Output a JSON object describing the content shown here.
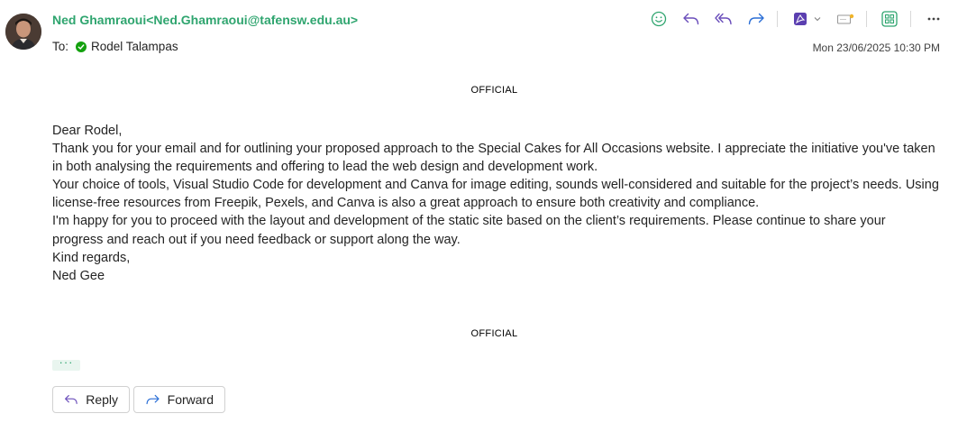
{
  "header": {
    "sender": "Ned Ghamraoui<Ned.Ghamraoui@tafensw.edu.au>",
    "to_label": "To:",
    "recipient": "Rodel Talampas",
    "date": "Mon 23/06/2025 10:30 PM"
  },
  "toolbar": {
    "icons": [
      "emoji-icon",
      "reply-icon",
      "reply-all-icon",
      "forward-icon",
      "pdf-icon",
      "chevron-down-icon",
      "edit-icon",
      "apps-icon",
      "more-icon"
    ]
  },
  "message": {
    "classification_top": "OFFICIAL",
    "greeting": "Dear Rodel,",
    "para1": "Thank you for your email and for outlining your proposed approach to the Special Cakes for All Occasions website. I appreciate the initiative you've taken in both analysing the requirements and offering to lead the web design and development work.",
    "para2": "Your choice of tools, Visual Studio Code for development and Canva for image editing, sounds well-considered and suitable for the project’s needs. Using license-free resources from Freepik, Pexels, and Canva is also a great approach to ensure both creativity and compliance.",
    "para3": "I'm happy for you to proceed with the layout and development of the static site based on the client’s requirements. Please continue to share your progress and reach out if you need feedback or support along the way.",
    "closing": "Kind regards,",
    "signature": "Ned Gee",
    "classification_bottom": "OFFICIAL",
    "ellipsis": "···"
  },
  "actions": {
    "reply_label": "Reply",
    "forward_label": "Forward"
  },
  "colors": {
    "accent_green": "#2fa56f",
    "icon_purple": "#6b4fbb",
    "status_green": "#13a10e"
  }
}
